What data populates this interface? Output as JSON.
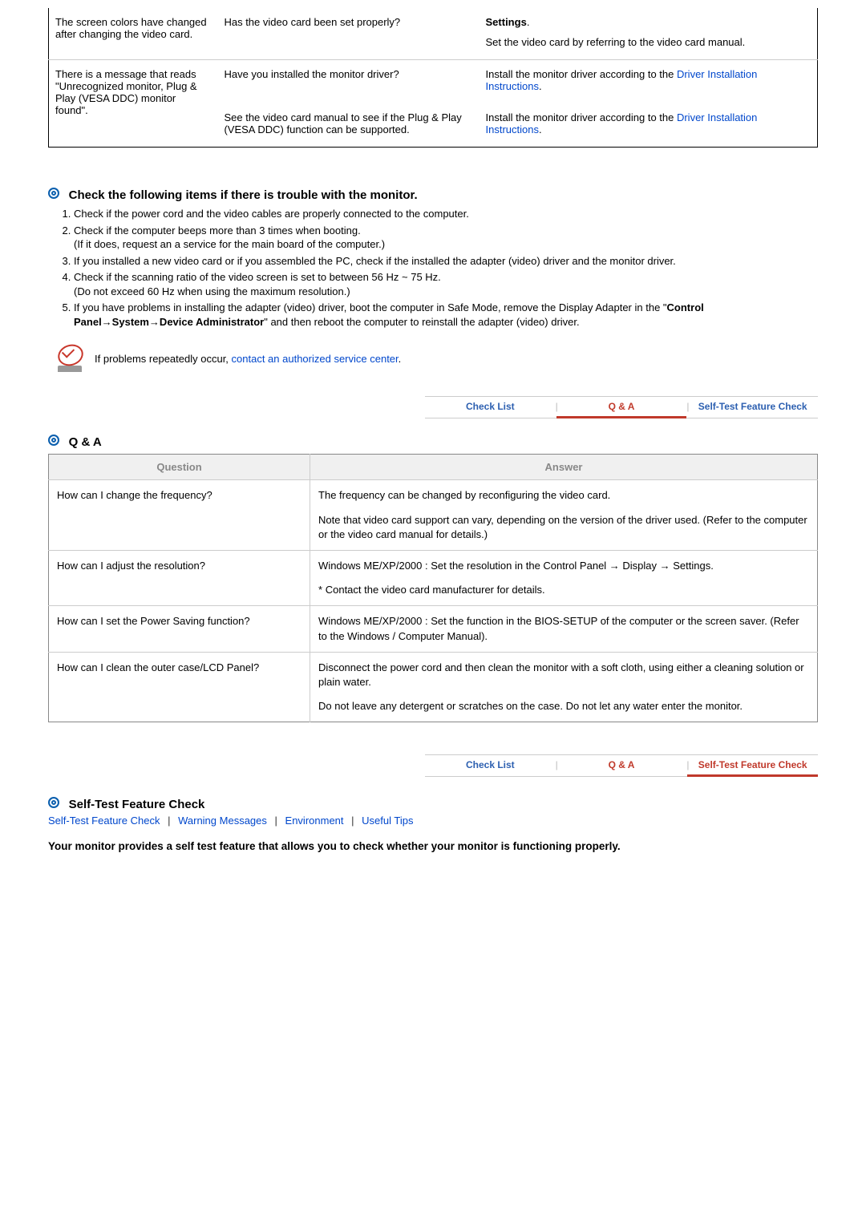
{
  "table1": {
    "r1c1": "The screen colors have changed after changing the video card.",
    "r1c2": "Has the video card been set properly?",
    "r1c3a": "Settings",
    "r1c3b": "Set the video card by referring to the video card manual.",
    "r2c1": "There is a message that reads \"Unrecognized monitor, Plug & Play (VESA DDC) monitor found\".",
    "r2c2a": "Have you installed the monitor driver?",
    "r2c2b": "See the video card manual to see if the Plug & Play (VESA DDC) function can be supported.",
    "r2c3a1": "Install the monitor driver according to the ",
    "r2c3a2": "Driver Installation Instructions",
    "r2c3b1": "Install the monitor driver according to the ",
    "r2c3b2": "Driver Installation Instructions"
  },
  "checkSection": {
    "title": "Check the following items if there is trouble with the monitor.",
    "i1": "Check if the power cord and the video cables are properly connected to the computer.",
    "i2a": "Check if the computer beeps more than 3 times when booting.",
    "i2b": "(If it does, request an a service for the main board of the computer.)",
    "i3": "If you installed a new video card or if you assembled the PC, check if the installed the adapter (video) driver and the monitor driver.",
    "i4a": "Check if the scanning ratio of the video screen is set to between 56 Hz ~ 75 Hz.",
    "i4b": "(Do not exceed 60 Hz when using the maximum resolution.)",
    "i5a": "If you have problems in installing the adapter (video) driver, boot the computer in Safe Mode, remove the Display Adapter in the \"",
    "i5b": "Control Panel→System→Device Administrator",
    "i5c": "\" and then reboot the computer to reinstall the adapter (video) driver.",
    "noteA": "If problems repeatedly occur, ",
    "noteB": "contact an authorized service center"
  },
  "tabs": {
    "checkList": "Check List",
    "qa": "Q & A",
    "selfTest": "Self-Test Feature Check"
  },
  "qaSection": {
    "title": "Q & A",
    "hQuestion": "Question",
    "hAnswer": "Answer",
    "q1": "How can I change the frequency?",
    "a1a": "The frequency can be changed by reconfiguring the video card.",
    "a1b": "Note that video card support can vary, depending on the version of the driver used. (Refer to the computer or the video card manual for details.)",
    "q2": "How can I adjust the resolution?",
    "a2a": "Windows ME/XP/2000 : Set the resolution in the Control Panel → Display → Settings.",
    "a2b": "* Contact the video card manufacturer for details.",
    "q3": "How can I set the Power Saving function?",
    "a3": "Windows ME/XP/2000 : Set the function in the BIOS-SETUP of the computer or the screen saver. (Refer to the Windows / Computer Manual).",
    "q4": "How can I clean the outer case/LCD Panel?",
    "a4a": "Disconnect the power cord and then clean the monitor with a soft cloth, using either a cleaning solution or plain water.",
    "a4b": "Do not leave any detergent or scratches on the case. Do not let any water enter the monitor."
  },
  "selfTestSection": {
    "title": "Self-Test Feature Check",
    "l1": "Self-Test Feature Check",
    "l2": "Warning Messages",
    "l3": "Environment",
    "l4": "Useful Tips",
    "bottom": "Your monitor provides a self test feature that allows you to check whether your monitor is functioning properly."
  }
}
